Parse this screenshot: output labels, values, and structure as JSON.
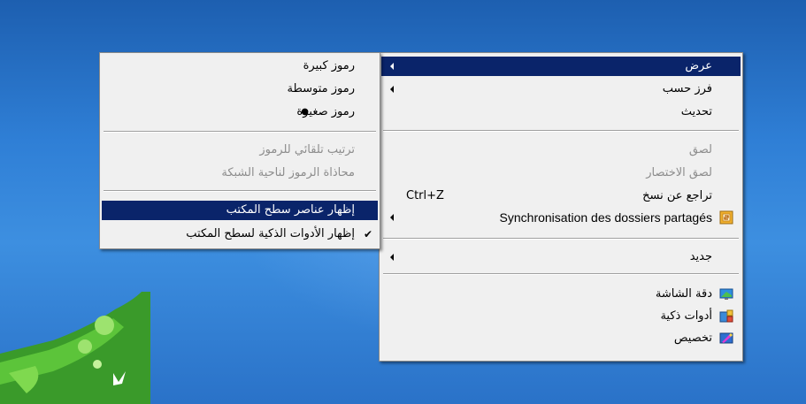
{
  "context_menu": {
    "items": [
      {
        "label": "عرض",
        "highlighted": true,
        "submenu": true
      },
      {
        "label": "فرز حسب",
        "submenu": true
      },
      {
        "label": "تحديث"
      },
      {
        "label": "لصق",
        "disabled": true
      },
      {
        "label": "لصق الاختصار",
        "disabled": true
      },
      {
        "label": "تراجع عن نسخ",
        "shortcut": "Ctrl+Z"
      },
      {
        "label": "Synchronisation des dossiers partagés",
        "submenu": true,
        "icon": "sync-folders-icon"
      },
      {
        "label": "جديد",
        "submenu": true
      },
      {
        "label": "دقة الشاشة",
        "icon": "screen-resolution-icon"
      },
      {
        "label": "أدوات ذكية",
        "icon": "gadgets-icon"
      },
      {
        "label": "تخصيص",
        "icon": "personalize-icon"
      }
    ]
  },
  "view_submenu": {
    "items": [
      {
        "label": "رموز كبيرة"
      },
      {
        "label": "رموز متوسطة"
      },
      {
        "label": "رموز صغيرة",
        "selected": true
      },
      {
        "label": "ترتيب تلقائي للرموز",
        "disabled": true
      },
      {
        "label": "محاذاة الرموز لناحية الشبكة",
        "disabled": true
      },
      {
        "label": "إظهار عناصر سطح المكتب",
        "highlighted": true
      },
      {
        "label": "إظهار الأدوات الذكية لسطح المكتب",
        "checked": true
      }
    ]
  },
  "marks": {
    "bullet": "●",
    "check": "✔"
  },
  "colors": {
    "highlight": "#0a246a",
    "menu_bg": "#f0f0f0",
    "disabled_text": "#8d8d8d"
  }
}
